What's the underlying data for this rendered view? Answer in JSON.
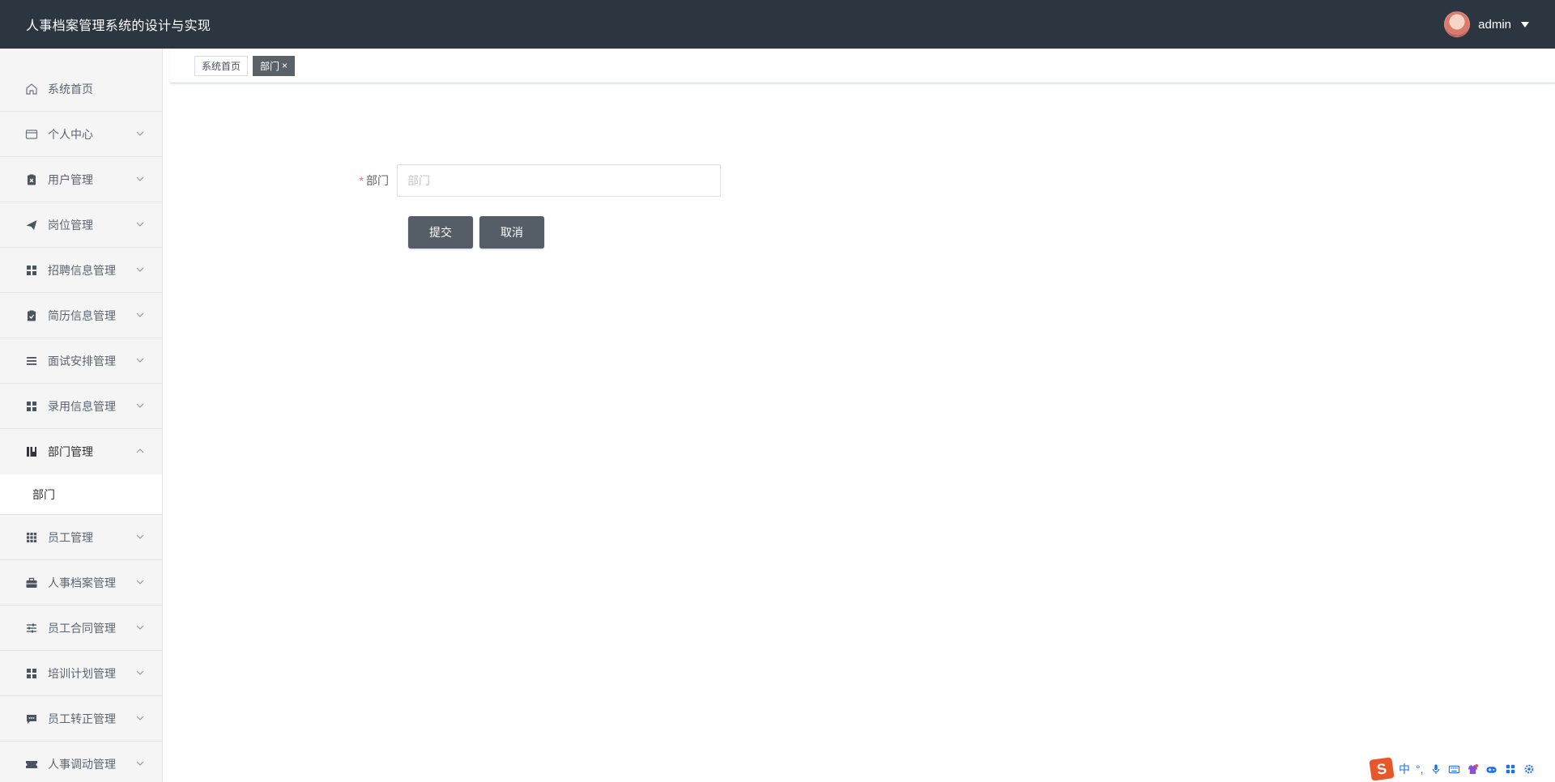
{
  "header": {
    "app_title": "人事档案管理系统的设计与实现",
    "username": "admin"
  },
  "sidebar": {
    "items": [
      {
        "label": "系统首页",
        "icon": "home-icon"
      },
      {
        "label": "个人中心",
        "icon": "wallet-icon"
      },
      {
        "label": "用户管理",
        "icon": "clipboard-x-icon"
      },
      {
        "label": "岗位管理",
        "icon": "send-icon"
      },
      {
        "label": "招聘信息管理",
        "icon": "grid-icon"
      },
      {
        "label": "简历信息管理",
        "icon": "clipboard-check-icon"
      },
      {
        "label": "面试安排管理",
        "icon": "list-icon"
      },
      {
        "label": "录用信息管理",
        "icon": "grid-icon"
      },
      {
        "label": "部门管理",
        "icon": "book-icon"
      },
      {
        "label": "员工管理",
        "icon": "grid-nine-icon"
      },
      {
        "label": "人事档案管理",
        "icon": "briefcase-icon"
      },
      {
        "label": "员工合同管理",
        "icon": "sliders-icon"
      },
      {
        "label": "培训计划管理",
        "icon": "grid-icon"
      },
      {
        "label": "员工转正管理",
        "icon": "chat-icon"
      },
      {
        "label": "人事调动管理",
        "icon": "ticket-icon"
      }
    ],
    "submenu_label": "部门"
  },
  "tabs": [
    {
      "label": "系统首页"
    },
    {
      "label": "部门"
    }
  ],
  "tab_close": "×",
  "form": {
    "required_mark": "*",
    "label": "部门",
    "placeholder": "部门",
    "value": "",
    "submit_label": "提交",
    "cancel_label": "取消"
  },
  "ime": {
    "logo": "S",
    "mode": "中",
    "punct": "°,"
  },
  "colors": {
    "header_bg": "#2b3640",
    "button_bg": "#555d66",
    "active_tab_bg": "#5a6168",
    "required": "#f56c6c"
  }
}
